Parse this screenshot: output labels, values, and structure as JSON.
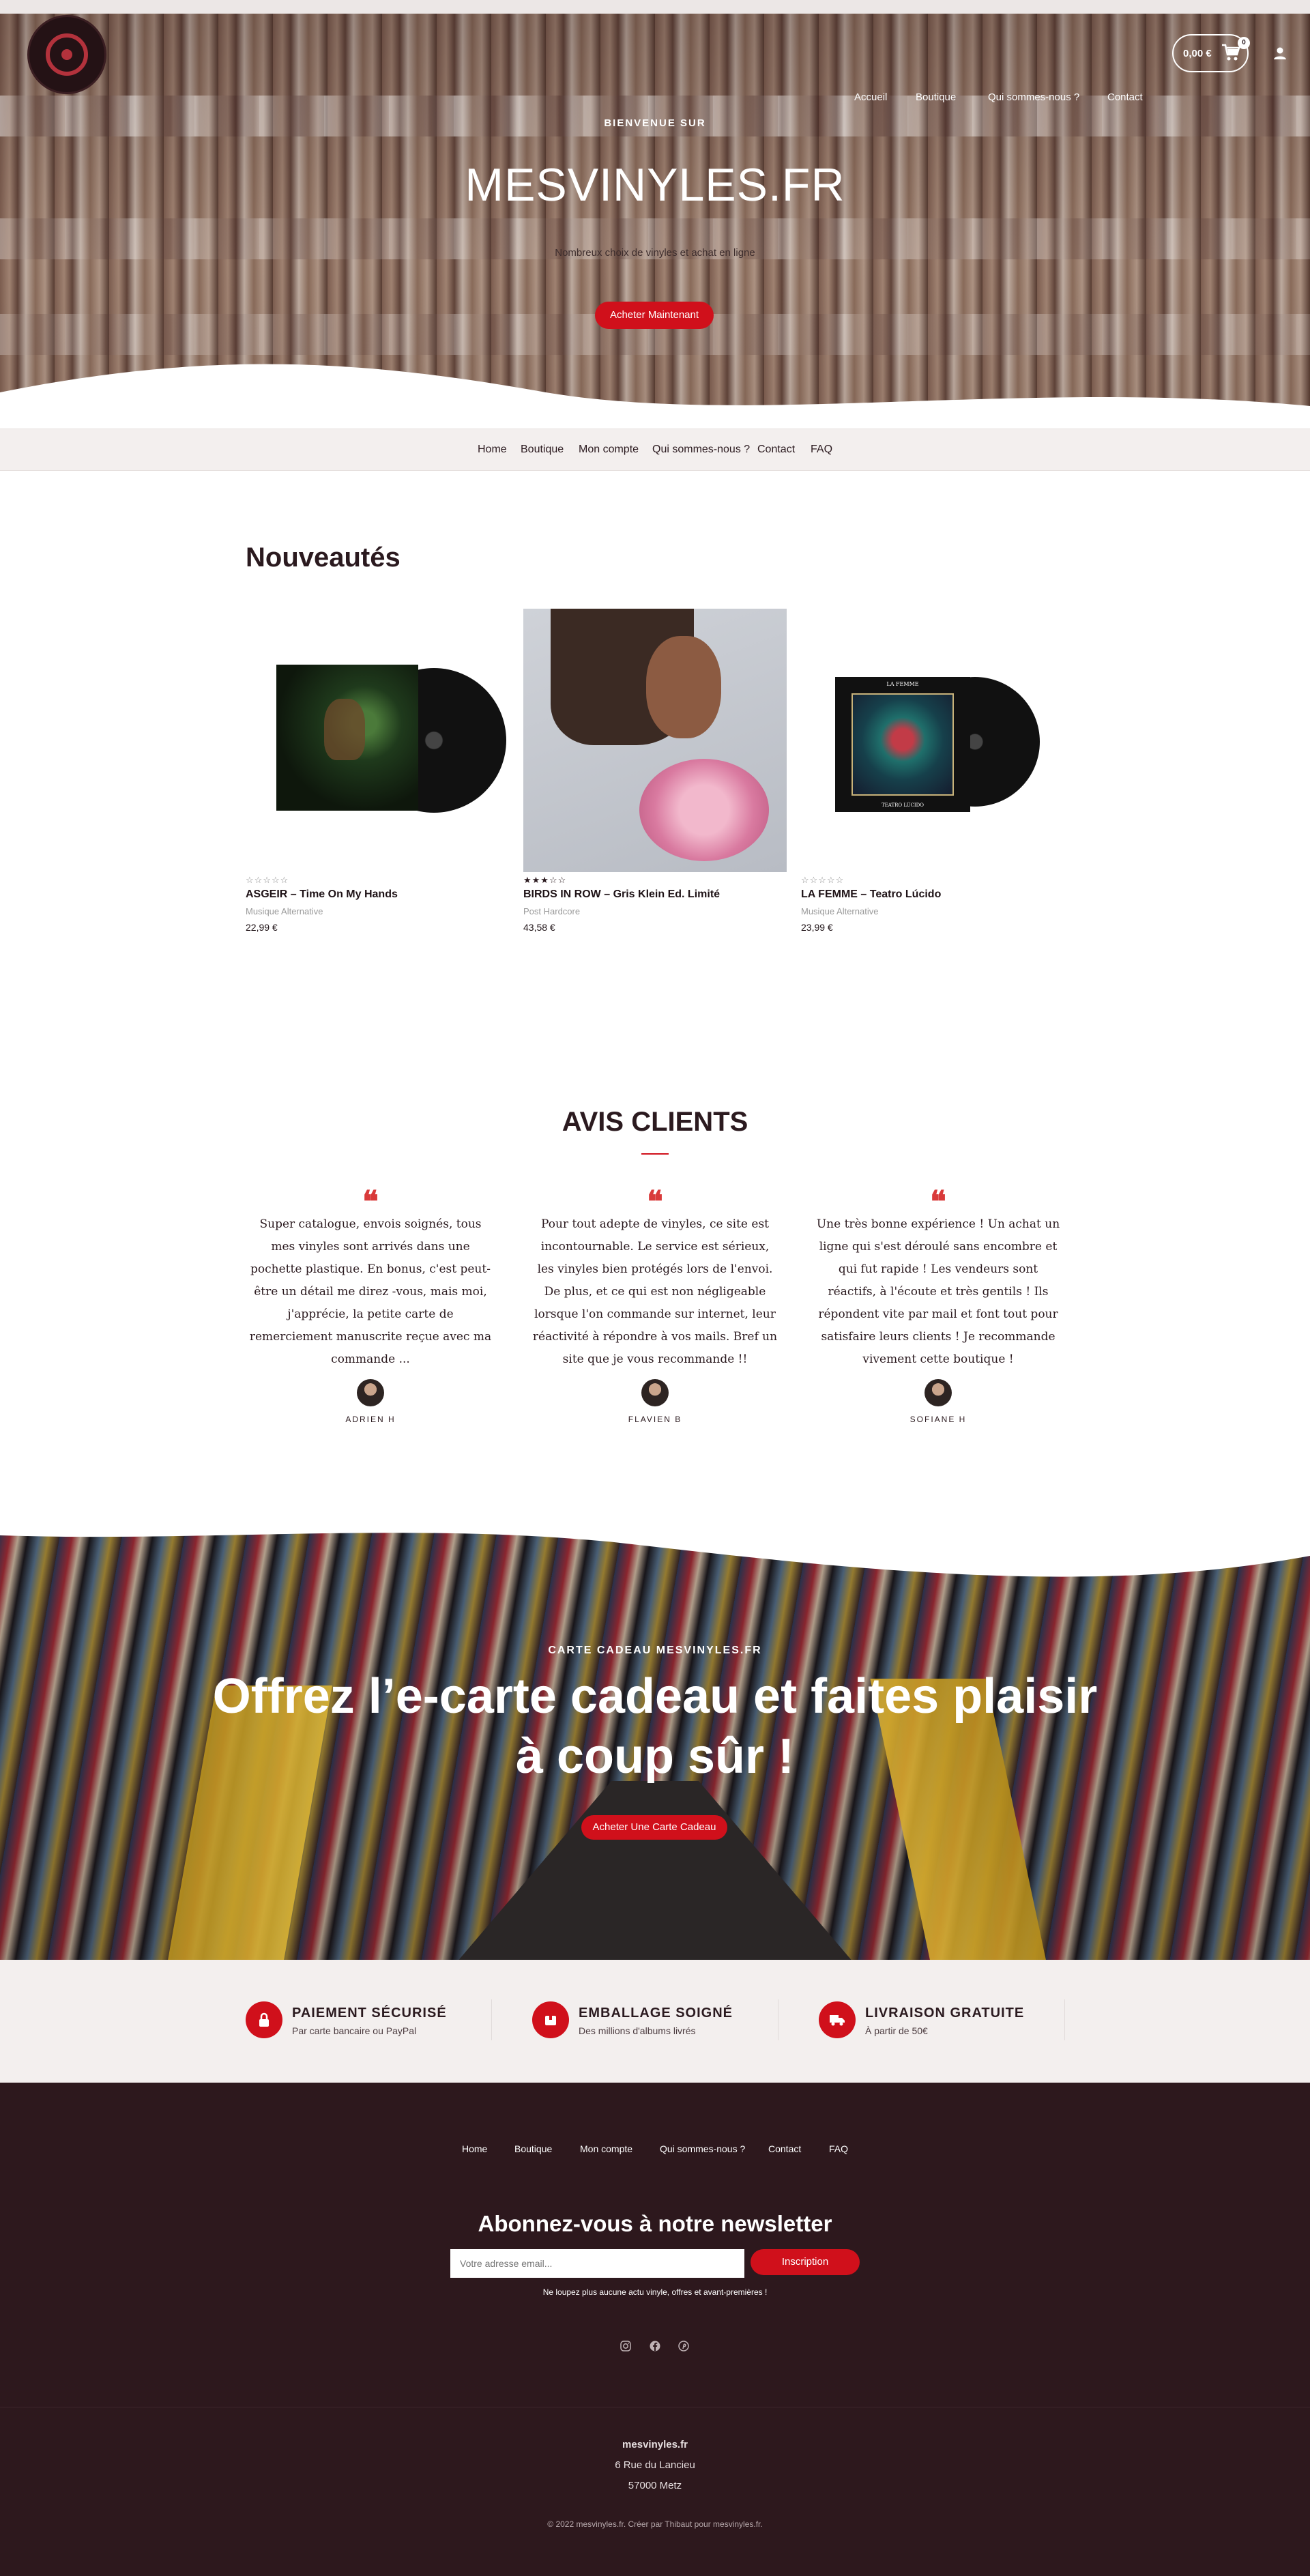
{
  "brand": {
    "name": "mesvinyles.fr"
  },
  "header": {
    "nav": [
      "Accueil",
      "Boutique",
      "Qui sommes-nous ?",
      "Contact"
    ],
    "cart_total": "0,00 €",
    "cart_count": "0"
  },
  "hero": {
    "eyebrow": "BIENVENUE SUR",
    "title": "MESVINYLES.FR",
    "subtitle": "Nombreux choix de vinyles et achat en ligne",
    "cta": "Acheter Maintenant"
  },
  "subnav": [
    "Home",
    "Boutique",
    "Mon compte",
    "Qui sommes-nous ?",
    "Contact",
    "FAQ"
  ],
  "new_products": {
    "title": "Nouveautés",
    "items": [
      {
        "stars": "☆☆☆☆☆",
        "rating": 0,
        "name": "ASGEIR – Time On My Hands",
        "category": "Musique Alternative",
        "price": "22,99 €"
      },
      {
        "stars": "★★★☆☆",
        "rating": 3,
        "name": "BIRDS IN ROW – Gris Klein Ed. Limité",
        "category": "Post Hardcore",
        "price": "43,58 €"
      },
      {
        "stars": "☆☆☆☆☆",
        "rating": 0,
        "name": "LA FEMME – Teatro Lúcido",
        "category": "Musique Alternative",
        "price": "23,99 €",
        "cover_text_top": "LA FEMME",
        "cover_text_bottom": "TEATRO LÚCIDO"
      }
    ]
  },
  "reviews": {
    "title": "AVIS CLIENTS",
    "quote_glyph": "❝",
    "items": [
      {
        "text": "Super catalogue, envois soignés, tous mes vinyles sont arrivés dans une pochette plastique. En bonus, c'est peut-être un détail me direz -vous, mais moi, j'apprécie, la petite carte de remerciement manuscrite reçue avec ma commande ...",
        "name": "ADRIEN H"
      },
      {
        "text": "Pour tout adepte de vinyles, ce site est incontournable. Le service est sérieux, les vinyles bien protégés lors de l'envoi. De plus, et ce qui est non négligeable lorsque l'on commande sur internet, leur réactivité à répondre à vos mails. Bref un site que je vous recommande !!",
        "name": "FLAVIEN B"
      },
      {
        "text": "Une très bonne expérience ! Un achat un ligne qui s'est déroulé sans encombre et qui fut rapide ! Les vendeurs sont réactifs, à l'écoute et très gentils ! Ils répondent vite par mail et font tout pour satisfaire leurs clients ! Je recommande vivement cette boutique !",
        "name": "SOFIANE H"
      }
    ]
  },
  "gift": {
    "eyebrow": "CARTE CADEAU MESVINYLES.FR",
    "title": "Offrez l’e-carte cadeau et faites plaisir à coup sûr !",
    "cta": "Acheter Une Carte Cadeau"
  },
  "features": [
    {
      "icon": "lock-icon",
      "title": "PAIEMENT SÉCURISÉ",
      "subtitle": "Par carte bancaire ou PayPal"
    },
    {
      "icon": "package-icon",
      "title": "EMBALLAGE SOIGNÉ",
      "subtitle": "Des millions d'albums livrés"
    },
    {
      "icon": "truck-icon",
      "title": "LIVRAISON GRATUITE",
      "subtitle": "À partir de 50€"
    }
  ],
  "footer": {
    "nav": [
      "Home",
      "Boutique",
      "Mon compte",
      "Qui sommes-nous ?",
      "Contact",
      "FAQ"
    ],
    "newsletter_title": "Abonnez-vous à notre newsletter",
    "newsletter_placeholder": "Votre adresse email...",
    "newsletter_button": "Inscription",
    "newsletter_note": "Ne loupez plus aucune actu vinyle, offres et avant-premières !",
    "social": [
      "instagram-icon",
      "facebook-icon",
      "pinterest-icon"
    ],
    "address": [
      "mesvinyles.fr",
      "6 Rue du Lancieu",
      "57000 Metz"
    ],
    "copyright": "© 2022 mesvinyles.fr. Créer par Thibaut pour mesvinyles.fr."
  },
  "colors": {
    "accent": "#d0101b",
    "dark": "#2d181d",
    "light_bg": "#f3efee"
  }
}
